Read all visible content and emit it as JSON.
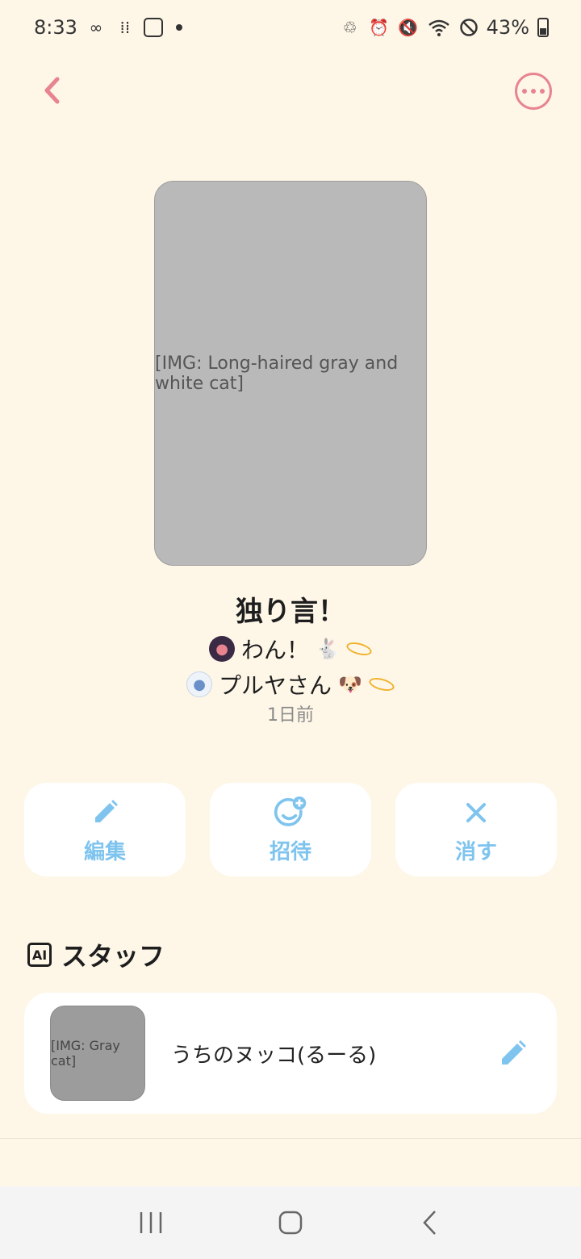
{
  "status_bar": {
    "time": "8:33",
    "battery": "43%",
    "icons": [
      "voicemail-icon",
      "grid-icon",
      "app-icon",
      "battery-saver-icon",
      "alarm-icon",
      "mute-icon",
      "wifi-icon",
      "dnd-icon",
      "battery-icon"
    ]
  },
  "header": {
    "back_icon": "chevron-left-icon",
    "more_icon": "more-horizontal-icon"
  },
  "room": {
    "title": "独り言！",
    "members": [
      {
        "name": "わん！",
        "emojis": "🐇"
      },
      {
        "name": "プルヤさん",
        "emojis": "🐶"
      }
    ],
    "updated": "1日前",
    "cover_photo_alt": "Long-haired gray and white cat"
  },
  "actions": {
    "edit_label": "編集",
    "invite_label": "招待",
    "delete_label": "消す"
  },
  "staff": {
    "badge": "AI",
    "heading": "スタッフ",
    "items": [
      {
        "name": "うちのヌッコ(るーる)",
        "avatar_alt": "Gray cat portrait"
      }
    ]
  },
  "colors": {
    "background": "#FEF7E8",
    "accent_pink": "#E8848F",
    "accent_blue": "#7EC4EE"
  }
}
